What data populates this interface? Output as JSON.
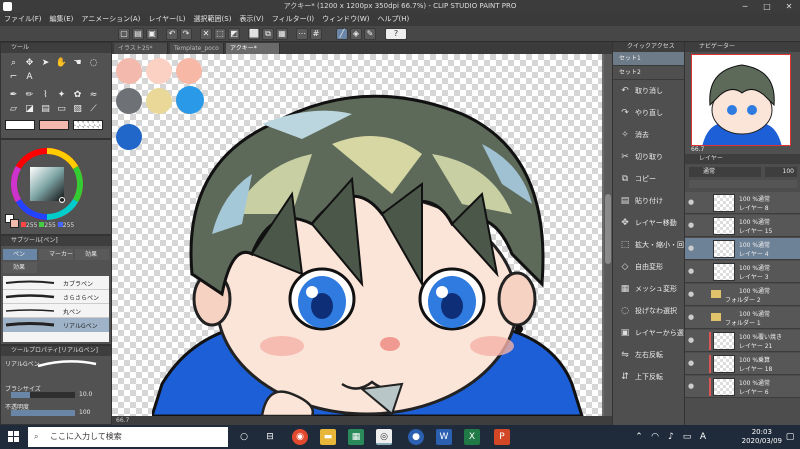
{
  "window": {
    "title": "アクキー* (1200 x 1200px 350dpi 66.7%)  - CLIP STUDIO PAINT PRO"
  },
  "menu": [
    "ファイル(F)",
    "編集(E)",
    "アニメーション(A)",
    "レイヤー(L)",
    "選択範囲(S)",
    "表示(V)",
    "フィルター(I)",
    "ウィンドウ(W)",
    "ヘルプ(H)"
  ],
  "left_panels": {
    "tool_panel_title": "ツール",
    "subtool_title": "サブツール[ペン]",
    "subtool_tabs": [
      "ペン",
      "マーカー",
      "効果"
    ],
    "extra_tab": "効果",
    "brushes": [
      "カブラペン",
      "さらさらペン",
      "丸ペン",
      "リアルGペン"
    ],
    "tool_property_title": "ツールプロパティ[リアルGペン]",
    "tool_property_name": "リアルGペン",
    "brush_size_label": "ブラシサイズ",
    "brush_size_value": "10.0",
    "opacity_label": "不透明度",
    "opacity_value": "100",
    "color_values": [
      "255",
      "255",
      "255"
    ]
  },
  "tabs": [
    "イラスト25*",
    "Template_poco",
    "アクキー*"
  ],
  "status": {
    "zoom": "66.7"
  },
  "quick_access": {
    "title": "クイックアクセス",
    "sets": [
      "セット1",
      "セット2"
    ],
    "items": [
      {
        "icon": "undo-icon",
        "label": "取り消し"
      },
      {
        "icon": "redo-icon",
        "label": "やり直し"
      },
      {
        "icon": "erase-icon",
        "label": "消去"
      },
      {
        "icon": "cut-icon",
        "label": "切り取り"
      },
      {
        "icon": "copy-icon",
        "label": "コピー"
      },
      {
        "icon": "paste-icon",
        "label": "貼り付け"
      },
      {
        "icon": "move-layer-icon",
        "label": "レイヤー移動"
      },
      {
        "icon": "scale-icon",
        "label": "拡大・縮小・回転"
      },
      {
        "icon": "free-transform-icon",
        "label": "自由変形"
      },
      {
        "icon": "mesh-icon",
        "label": "メッシュ変形"
      },
      {
        "icon": "lasso-icon",
        "label": "投げなわ選択"
      },
      {
        "icon": "layer-selection-icon",
        "label": "レイヤーから選択範囲を作成"
      },
      {
        "icon": "flip-h-icon",
        "label": "左右反転"
      },
      {
        "icon": "flip-v-icon",
        "label": "上下反転"
      }
    ]
  },
  "navigator": {
    "title": "ナビゲーター",
    "zoom": "66.7"
  },
  "layers": {
    "title": "レイヤー",
    "blend_mode": "通常",
    "opacity": "100",
    "rows": [
      {
        "type": "layer",
        "pct": "100 %通常",
        "name": "レイヤー 8",
        "selected": false
      },
      {
        "type": "layer",
        "pct": "100 %通常",
        "name": "レイヤー 15",
        "selected": false
      },
      {
        "type": "layer",
        "pct": "100 %通常",
        "name": "レイヤー 4",
        "selected": true
      },
      {
        "type": "layer",
        "pct": "100 %通常",
        "name": "レイヤー 3",
        "selected": false
      },
      {
        "type": "folder",
        "pct": "100 %通常",
        "name": "フォルダー 2",
        "selected": false
      },
      {
        "type": "folder",
        "pct": "100 %通常",
        "name": "フォルダー 1",
        "selected": false
      },
      {
        "type": "layer",
        "pct": "100 %覆い焼き",
        "name": "レイヤー 21",
        "selected": false
      },
      {
        "type": "layer",
        "pct": "100 %乗算",
        "name": "レイヤー 18",
        "selected": false
      },
      {
        "type": "layer",
        "pct": "100 %通常",
        "name": "レイヤー 6",
        "selected": false
      }
    ]
  },
  "taskbar": {
    "search_placeholder": "ここに入力して検索",
    "time": "20:03",
    "date": "2020/03/09",
    "ime": "A"
  },
  "palette": [
    "#f4b9ad",
    "#fbd1c4",
    "#f7b8a6",
    "#6e7277",
    "#e9d897",
    "#9aa3a8",
    "#2a9ae8",
    "#2067c9"
  ]
}
